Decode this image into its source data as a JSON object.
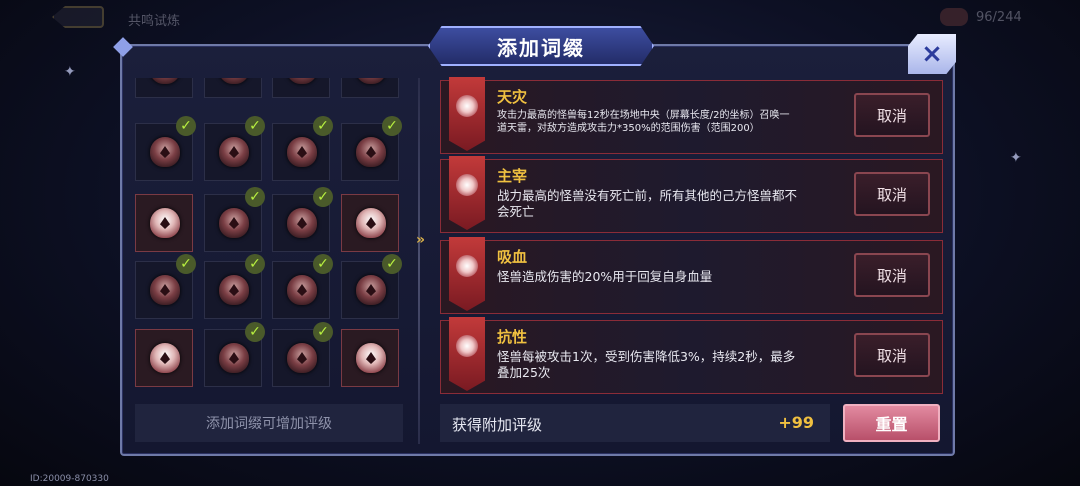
{
  "topbar": {
    "title": "共鸣试炼",
    "count": "96/244"
  },
  "dialog": {
    "title": "添加词缀",
    "close_icon": "×"
  },
  "grid": {
    "rows": [
      {
        "cells": [
          {
            "icon": "claw-emblem-icon",
            "checked": false,
            "selected": false
          },
          {
            "icon": "shield-emblem-icon",
            "checked": false,
            "selected": false
          },
          {
            "icon": "helm-emblem-icon",
            "checked": false,
            "selected": false
          },
          {
            "icon": "crown-emblem-icon",
            "checked": false,
            "selected": false
          }
        ]
      },
      {
        "cells": [
          {
            "icon": "burst-emblem-icon",
            "checked": true,
            "selected": false
          },
          {
            "icon": "eye-emblem-icon",
            "checked": true,
            "selected": false
          },
          {
            "icon": "slash-emblem-icon",
            "checked": true,
            "selected": false
          },
          {
            "icon": "pyramid-emblem-icon",
            "checked": true,
            "selected": false
          }
        ]
      },
      {
        "cells": [
          {
            "icon": "fist-emblem-icon",
            "checked": false,
            "selected": true
          },
          {
            "icon": "heart-emblem-icon",
            "checked": true,
            "selected": false
          },
          {
            "icon": "arrow-emblem-icon",
            "checked": true,
            "selected": false
          },
          {
            "icon": "swirl-emblem-icon",
            "checked": false,
            "selected": true
          }
        ]
      },
      {
        "cells": [
          {
            "icon": "rank-emblem-icon",
            "checked": true,
            "selected": false
          },
          {
            "icon": "sword-emblem-icon",
            "checked": true,
            "selected": false
          },
          {
            "icon": "fang-emblem-icon",
            "checked": true,
            "selected": false
          },
          {
            "icon": "star-emblem-icon",
            "checked": true,
            "selected": false
          }
        ]
      },
      {
        "cells": [
          {
            "icon": "serpent-emblem-icon",
            "checked": false,
            "selected": true
          },
          {
            "icon": "drop-emblem-icon",
            "checked": true,
            "selected": false
          },
          {
            "icon": "round-shield-emblem-icon",
            "checked": true,
            "selected": false
          },
          {
            "icon": "armor-emblem-icon",
            "checked": false,
            "selected": true
          }
        ]
      }
    ],
    "check_glyph": "✓"
  },
  "hint": "添加词缀可增加评级",
  "arrow_glyph": "»",
  "affixes": [
    {
      "name": "天灾",
      "desc": "攻击力最高的怪兽每12秒在场地中央（屏幕长度/2的坐标）召唤一道天雷，对敌方造成攻击力*350%的范围伤害（范围200）",
      "small": true,
      "icon": "lightning-icon",
      "cancel": "取消"
    },
    {
      "name": "主宰",
      "desc": "战力最高的怪兽没有死亡前，所有其他的己方怪兽都不会死亡",
      "small": false,
      "icon": "star-burst-icon",
      "cancel": "取消"
    },
    {
      "name": "吸血",
      "desc": "怪兽造成伤害的20%用于回复自身血量",
      "small": false,
      "icon": "blood-drop-icon",
      "cancel": "取消"
    },
    {
      "name": "抗性",
      "desc": "怪兽每被攻击1次，受到伤害降低3%，持续2秒，最多叠加25次",
      "small": false,
      "icon": "shield-icon",
      "cancel": "取消"
    }
  ],
  "bonus": {
    "label": "获得附加评级",
    "value": "+99"
  },
  "reset_label": "重置",
  "footer_id": "ID:20009-870330",
  "colors": {
    "accent_gold": "#f0c040",
    "affix_red": "#8a2c38",
    "check_green": "#b8f040"
  }
}
